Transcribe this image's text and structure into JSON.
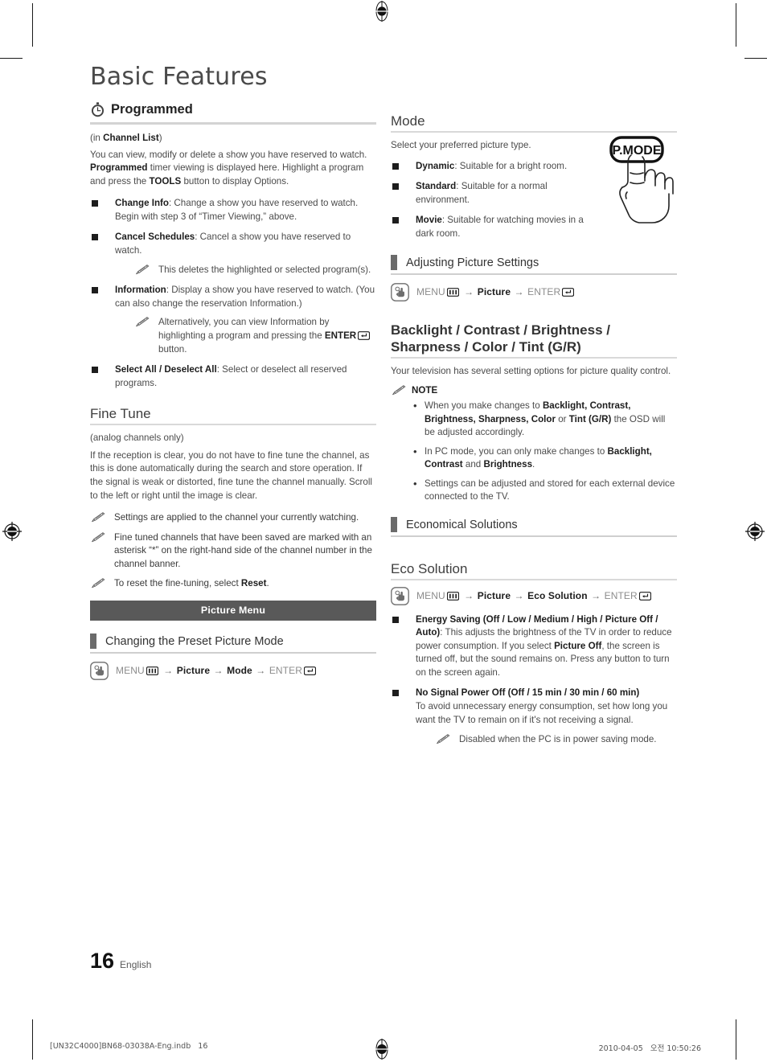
{
  "page": {
    "title": "Basic Features",
    "number": "16",
    "language": "English",
    "footer_left": "[UN32C4000]BN68-03038A-Eng.indb   16",
    "footer_right": "2010-04-05   오전 10:50:26"
  },
  "left_column": {
    "programmed": {
      "icon": "stopwatch-icon",
      "heading": "Programmed",
      "subnote_prefix": "(in ",
      "subnote_bold": "Channel List",
      "subnote_suffix": ")",
      "intro": "You can view, modify or delete a show you have reserved to watch. Programmed timer viewing is displayed here. Highlight a program and press the TOOLS button to display Options.",
      "bullets": [
        {
          "term": "Change Info",
          "text": ": Change a show you have reserved to watch. Begin with step 3 of “Timer Viewing,” above."
        },
        {
          "term": "Cancel Schedules",
          "text": ": Cancel a show you have reserved to watch.",
          "note": "This deletes the highlighted or selected program(s)."
        },
        {
          "term": "Information",
          "text": ": Display a show you have reserved to watch. (You can also change the reservation Information.)",
          "note": "Alternatively, you can view Information by highlighting a program and pressing the ENTER button."
        },
        {
          "term": "Select All / Deselect All",
          "text": ": Select or deselect all reserved programs."
        }
      ]
    },
    "fine_tune": {
      "heading": "Fine Tune",
      "subnote": "(analog channels only)",
      "body": "If the reception is clear, you do not have to fine tune the channel, as this is done automatically during the search and store operation. If the signal is weak or distorted, fine tune the channel manually. Scroll to the left or right until the image is clear.",
      "notes": [
        "Settings are applied to the channel your currently watching.",
        "Fine tuned channels that have been saved are marked with an asterisk “*” on the right-hand side of the channel number in the channel banner.",
        "To reset the fine-tuning, select Reset."
      ]
    },
    "picture_menu_banner": "Picture Menu",
    "preset_mode": {
      "subheading": "Changing the Preset Picture Mode",
      "path": {
        "menu": "MENU",
        "arrow": "→",
        "steps": [
          "Picture",
          "Mode"
        ],
        "enter": "ENTER"
      }
    }
  },
  "right_column": {
    "mode": {
      "heading": "Mode",
      "intro": "Select your preferred picture type.",
      "remote_button": "P.MODE",
      "bullets": [
        {
          "term": "Dynamic",
          "text": ": Suitable for a bright room."
        },
        {
          "term": "Standard",
          "text": ": Suitable for a normal environment."
        },
        {
          "term": "Movie",
          "text": ": Suitable for watching movies in a dark room."
        }
      ]
    },
    "adjusting": {
      "subheading": "Adjusting Picture Settings",
      "path": {
        "menu": "MENU",
        "arrow": "→",
        "steps": [
          "Picture"
        ],
        "enter": "ENTER"
      }
    },
    "backlight": {
      "heading_line1": "Backlight / Contrast / Brightness /",
      "heading_line2": "Sharpness / Color / Tint (G/R)",
      "body": "Your television has several setting options for picture quality control.",
      "note_label": "NOTE",
      "notes": [
        "When you make changes to Backlight, Contrast, Brightness, Sharpness, Color or Tint (G/R) the OSD will be adjusted accordingly.",
        "In PC mode, you can only make changes to Backlight, Contrast and Brightness.",
        "Settings can be adjusted and stored for each external device connected to the TV."
      ]
    },
    "economical": {
      "subheading": "Economical Solutions"
    },
    "eco_solution": {
      "heading": "Eco Solution",
      "path": {
        "menu": "MENU",
        "arrow": "→",
        "steps": [
          "Picture",
          "Eco Solution"
        ],
        "enter": "ENTER"
      },
      "bullets": [
        {
          "term": "Energy Saving (Off / Low / Medium / High / Picture Off / Auto)",
          "text": ": This adjusts the brightness of the TV in order to reduce power consumption. If you select Picture Off, the screen is turned off, but the sound remains on. Press any button to turn on the screen again."
        },
        {
          "term": "No Signal Power Off (Off / 15 min / 30 min / 60 min)",
          "text": "To avoid unnecessary energy consumption, set how long you want the TV to remain on if it's not receiving a signal.",
          "note": "Disabled when the PC is in power saving mode."
        }
      ]
    }
  },
  "colors": {
    "banner_bg": "#595959",
    "heading_rule": "#d3d3d3",
    "block_marker": "#6b6b6b",
    "body_text": "#4b4b4b"
  }
}
